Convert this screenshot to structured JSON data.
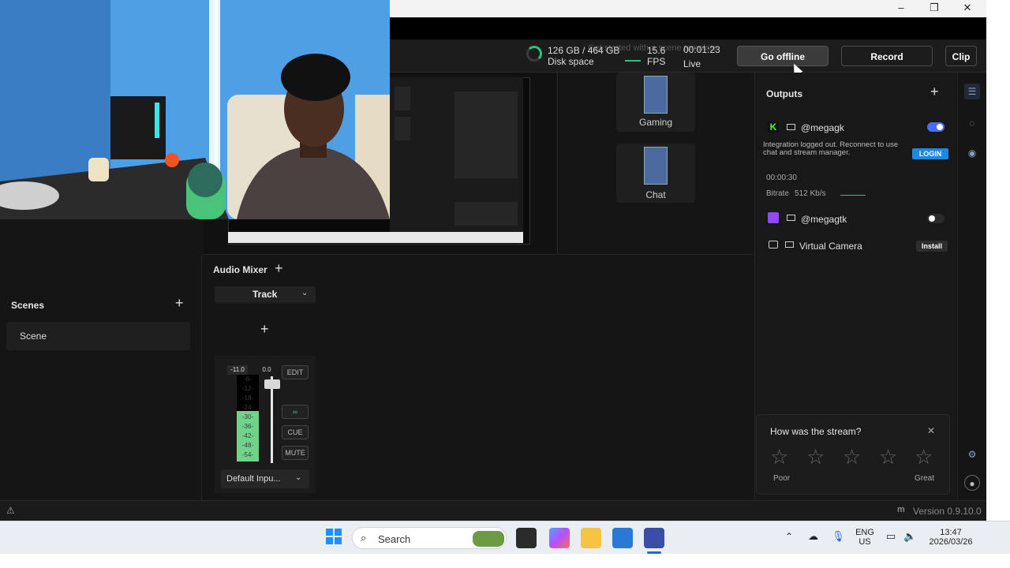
{
  "window": {
    "minimize": "–",
    "restore": "❐",
    "close": "✕"
  },
  "topbar": {
    "disk_space_value": "126 GB / 464 GB",
    "disk_space_label": "Disk space",
    "fps_value": "15.6",
    "fps_label": "FPS",
    "live_time": "00:01:23",
    "live_label": "Live",
    "ghost_text": "Get started with a scene template",
    "go_offline": "Go offline",
    "record": "Record",
    "clip": "Clip"
  },
  "stream_scenes": [
    {
      "label": "Gaming"
    },
    {
      "label": "Chat"
    }
  ],
  "outputs": {
    "title": "Outputs",
    "add": "+",
    "kick": {
      "handle": "@megagk",
      "toggle_on": true,
      "notice": "Integration logged out. Reconnect to use chat and stream manager.",
      "login": "LOGIN",
      "time": "00:00:30",
      "bitrate_label": "Bitrate",
      "bitrate_value": "512 Kb/s"
    },
    "twitch": {
      "handle": "@megagtk",
      "toggle_on": false
    },
    "virtual_camera": {
      "label": "Virtual Camera",
      "install": "Install"
    }
  },
  "scenes": {
    "title": "Scenes",
    "add": "+",
    "items": [
      {
        "label": "Scene"
      }
    ]
  },
  "audio_mixer": {
    "title": "Audio Mixer",
    "add": "+",
    "track": {
      "name": "Track",
      "add": "+",
      "level_db": "-11.0",
      "fader_db": "0.0",
      "edit": "EDIT",
      "cue": "CUE",
      "mute": "MUTE",
      "meter_ticks": [
        "-6-",
        "-12-",
        "-18-",
        "-24-",
        "-30-",
        "-36-",
        "-42-",
        "-48-",
        "-54-"
      ],
      "input": "Default Inpu..."
    }
  },
  "feedback": {
    "question": "How was the stream?",
    "close": "✕",
    "low_label": "Poor",
    "high_label": "Great",
    "stars": [
      "☆",
      "☆",
      "☆",
      "☆",
      "☆"
    ]
  },
  "status": {
    "version": "Version 0.9.10.0"
  },
  "taskbar": {
    "search": "Search",
    "lang_top": "ENG",
    "lang_bottom": "US",
    "time": "13:47",
    "date": "2026/03/26"
  },
  "colors": {
    "accent": "#2ec27e",
    "toggle_on": "#4a6cf7",
    "login": "#1e88e5",
    "kick": "#53fc18",
    "twitch": "#9146ff"
  }
}
